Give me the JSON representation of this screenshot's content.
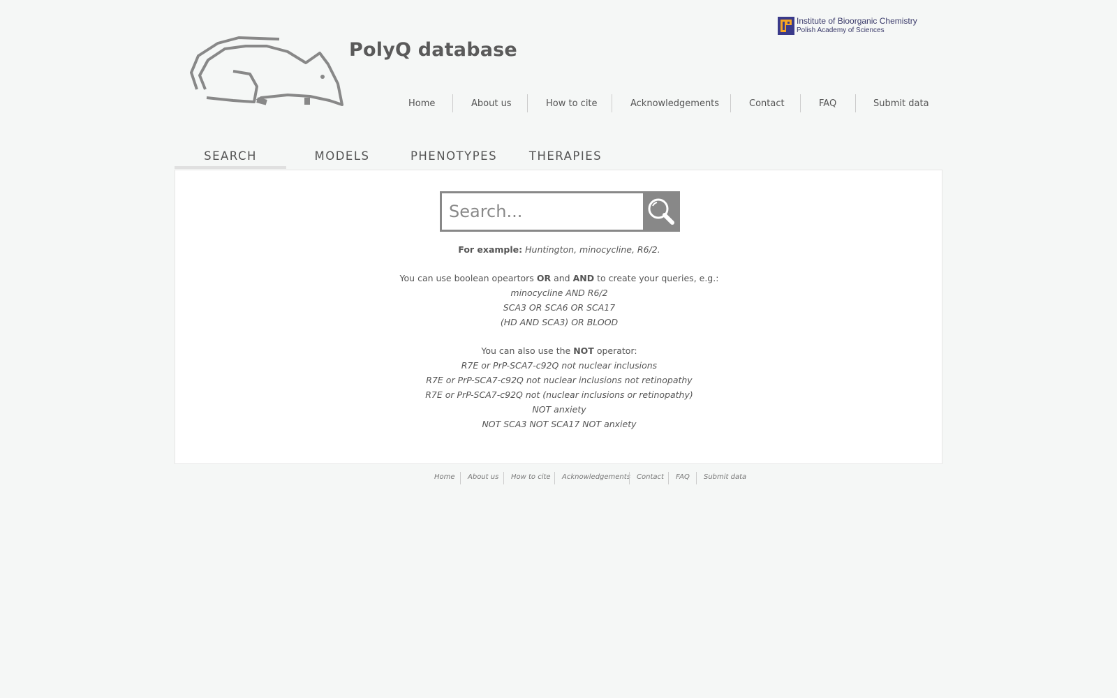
{
  "site": {
    "title": "PolyQ database"
  },
  "institute": {
    "line1": "Institute of Bioorganic Chemistry",
    "line2": "Polish Academy of Sciences"
  },
  "nav": [
    "Home",
    "About us",
    "How to cite",
    "Acknowledgements",
    "Contact",
    "FAQ",
    "Submit data"
  ],
  "tabs": [
    "SEARCH",
    "MODELS",
    "PHENOTYPES",
    "THERAPIES"
  ],
  "search": {
    "placeholder": "Search..."
  },
  "help": {
    "example_label": "For example:",
    "example_text": "Huntington, minocycline, R6/2.",
    "boolean_pre": "You can use boolean opeartors",
    "op_or": "OR",
    "and_word": "and",
    "op_and": "AND",
    "boolean_post": "to create your queries, e.g.:",
    "boolean_examples": [
      "minocycline AND R6/2",
      "SCA3 OR SCA6 OR SCA17",
      "(HD AND SCA3) OR BLOOD"
    ],
    "not_pre": "You can also use the",
    "op_not": "NOT",
    "not_post": "operator:",
    "not_examples": [
      "R7E or PrP-SCA7-c92Q not nuclear inclusions",
      "R7E or PrP-SCA7-c92Q not nuclear inclusions not retinopathy",
      "R7E or PrP-SCA7-c92Q not (nuclear inclusions or retinopathy)",
      "NOT anxiety",
      "NOT SCA3 NOT SCA17 NOT anxiety"
    ]
  },
  "footer_nav": [
    "Home",
    "About us",
    "How to cite",
    "Acknowledgements",
    "Contact",
    "FAQ",
    "Submit data"
  ],
  "colors": {
    "background": "#f5f7f6",
    "panel": "#ffffff",
    "accent_gray": "#888888",
    "logo_orange": "#f5a623",
    "logo_navy": "#3a3a8a"
  }
}
